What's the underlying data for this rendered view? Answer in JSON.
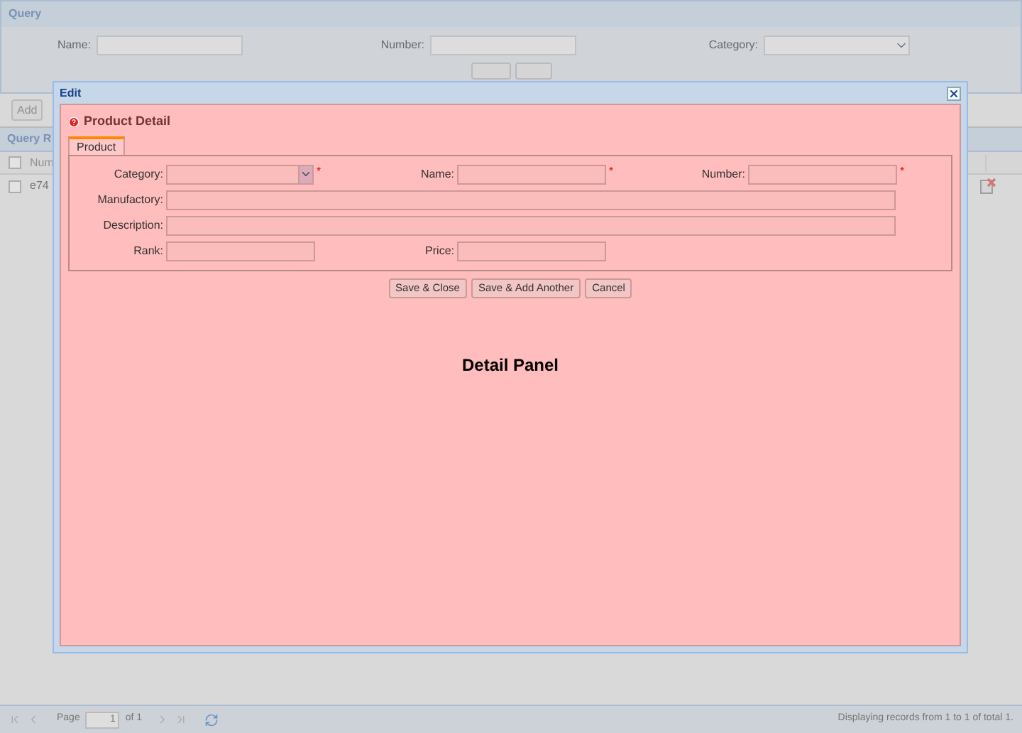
{
  "query_panel": {
    "title": "Query",
    "fields": [
      {
        "label": "Name:",
        "kind": "text"
      },
      {
        "label": "Number:",
        "kind": "text"
      },
      {
        "label": "Category:",
        "kind": "select"
      }
    ]
  },
  "toolbar": {
    "buttons": [
      "Add"
    ]
  },
  "results": {
    "title": "Query R",
    "all_checked": false,
    "columns": [
      "Num"
    ],
    "rows": [
      {
        "checked": false,
        "cells": [
          "e74"
        ]
      }
    ]
  },
  "dialog": {
    "title": "Edit",
    "panel_title": "Product Detail",
    "tabs": [
      {
        "label": "Product",
        "selected": true
      }
    ],
    "field_rows": [
      [
        {
          "label": "Category:",
          "kind": "select",
          "required_mark": "*"
        },
        {
          "label": "Name:",
          "kind": "text",
          "required_mark": "*"
        },
        {
          "label": "Number:",
          "kind": "text",
          "required_mark": "*"
        }
      ],
      [
        {
          "label": "Manufactory:",
          "kind": "wide"
        }
      ],
      [
        {
          "label": "Description:",
          "kind": "wide"
        }
      ],
      [
        {
          "label": "Rank:",
          "kind": "text"
        },
        {
          "label": "Price:",
          "kind": "text"
        }
      ]
    ],
    "buttons": [
      "Save & Close",
      "Save & Add Another",
      "Cancel"
    ],
    "body_text": "Detail Panel"
  },
  "paging": {
    "page_label": "Page",
    "page": "1",
    "of": "of 1",
    "status": "Displaying records from 1 to 1 of total 1."
  }
}
